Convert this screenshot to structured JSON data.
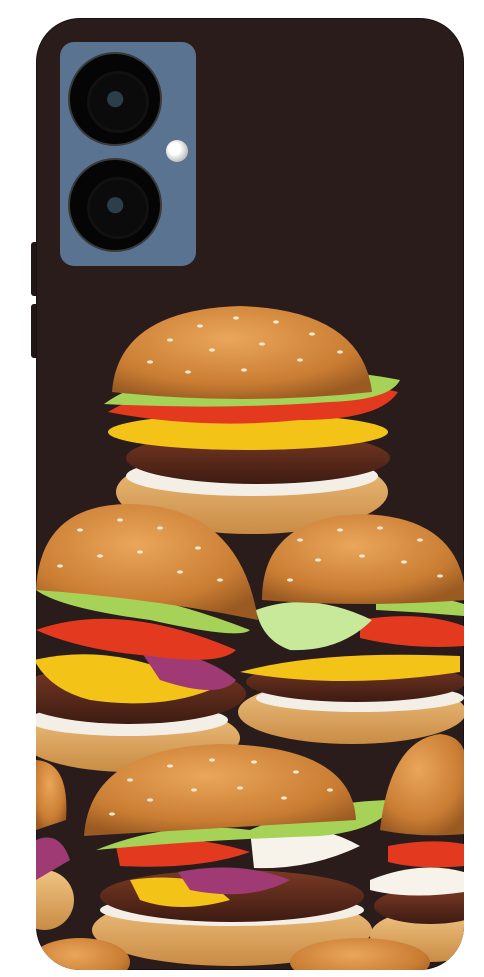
{
  "image": {
    "subject": "burger-print-phone-case",
    "colors": {
      "case_background": "#2a1c1b",
      "camera_island": "#5a7391",
      "bun": "#d18a3c",
      "patty": "#5a2a1e",
      "lettuce": "#a6d257",
      "tomato": "#e3391f",
      "cheese": "#f4c318",
      "onion": "#a03a74"
    }
  }
}
